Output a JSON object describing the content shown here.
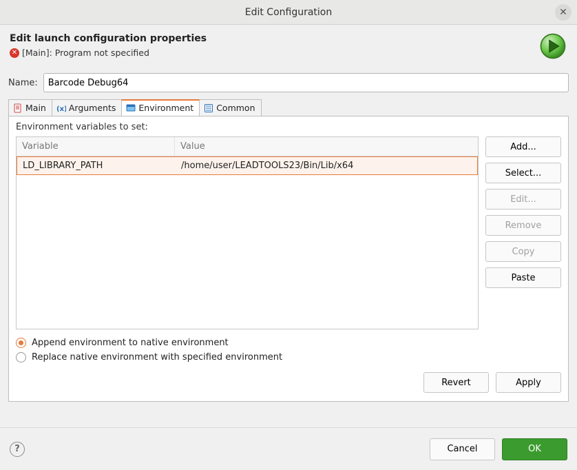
{
  "title": "Edit Configuration",
  "heading": "Edit launch configuration properties",
  "error_msg": "[Main]: Program not specified",
  "name_label": "Name:",
  "name_value": "Barcode Debug64",
  "tabs": {
    "main": "Main",
    "arguments": "Arguments",
    "environment": "Environment",
    "common": "Common"
  },
  "env_section_label": "Environment variables to set:",
  "table_headers": {
    "variable": "Variable",
    "value": "Value"
  },
  "env_rows": [
    {
      "variable": "LD_LIBRARY_PATH",
      "value": "/home/user/LEADTOOLS23/Bin/Lib/x64"
    }
  ],
  "side_buttons": {
    "add": "Add...",
    "select": "Select...",
    "edit": "Edit...",
    "remove": "Remove",
    "copy": "Copy",
    "paste": "Paste"
  },
  "radio_append": "Append environment to native environment",
  "radio_replace": "Replace native environment with specified environment",
  "footer": {
    "revert": "Revert",
    "apply": "Apply"
  },
  "bottom": {
    "cancel": "Cancel",
    "ok": "OK"
  }
}
